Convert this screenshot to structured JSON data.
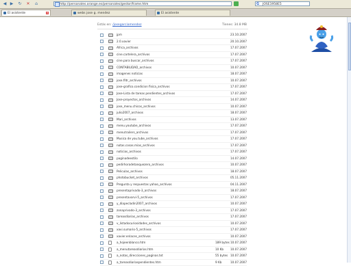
{
  "browser": {
    "address": "http://personales.orange.es/personales/gestor/frame.htm",
    "search_value": "JOSE1958E5",
    "tabs": [
      {
        "label": "El asistente",
        "active": true
      },
      {
        "label": "webs jose g. mendez",
        "active": false
      },
      {
        "label": "El asistente",
        "active": false
      }
    ]
  },
  "file_list": {
    "path_label": "Estás en:",
    "path_link": "/josegarciamendez",
    "space_label": "Tienes: 34.8 MB",
    "rows": [
      {
        "name": "jpm",
        "size": "",
        "date": "23.10.2007",
        "type": "folder"
      },
      {
        "name": "2.0.xavier",
        "size": "",
        "date": "20.10.2007",
        "type": "folder"
      },
      {
        "name": "Africa_archivos",
        "size": "",
        "date": "17.07.2007",
        "type": "folder"
      },
      {
        "name": "cine.cartelera_archivos",
        "size": "",
        "date": "17.07.2007",
        "type": "folder"
      },
      {
        "name": "cine.para buscar_archivos",
        "size": "",
        "date": "17.07.2007",
        "type": "folder"
      },
      {
        "name": "CONTABILIDAD_archivos",
        "size": "",
        "date": "10.07.2007",
        "type": "folder"
      },
      {
        "name": "imagenes noticias",
        "size": "",
        "date": "18.07.2007",
        "type": "folder"
      },
      {
        "name": "jose.filtr_archivos",
        "size": "",
        "date": "10.07.2007",
        "type": "folder"
      },
      {
        "name": "jose-grafico.condicion fisica_archivos",
        "size": "",
        "date": "17.07.2007",
        "type": "folder"
      },
      {
        "name": "Jose-Lista de tareas pendientes_archivos",
        "size": "",
        "date": "17.07.2007",
        "type": "folder"
      },
      {
        "name": "Jose-proyectos_archivos",
        "size": "",
        "date": "14.07.2007",
        "type": "folder"
      },
      {
        "name": "jose_menu.chicos_archivos",
        "size": "",
        "date": "10.07.2007",
        "type": "folder"
      },
      {
        "name": "julio2007_archivos",
        "size": "",
        "date": "18.07.2007",
        "type": "folder"
      },
      {
        "name": "Mari_archivos",
        "size": "",
        "date": "13.07.2007",
        "type": "folder"
      },
      {
        "name": "menu.youtube_archivos",
        "size": "",
        "date": "17.07.2007",
        "type": "folder"
      },
      {
        "name": "menutrailers_archivos",
        "size": "",
        "date": "17.07.2007",
        "type": "folder"
      },
      {
        "name": "Musica de you.tube_archivos",
        "size": "",
        "date": "17.07.2007",
        "type": "folder"
      },
      {
        "name": "notas.cosas.mias_archivos",
        "size": "",
        "date": "17.07.2007",
        "type": "folder"
      },
      {
        "name": "noticias_archivos",
        "size": "",
        "date": "17.07.2007",
        "type": "folder"
      },
      {
        "name": "paginadeestilo",
        "size": "",
        "date": "14.07.2007",
        "type": "folder"
      },
      {
        "name": "pedirhoradetanquezero_archivos",
        "size": "",
        "date": "10.07.2007",
        "type": "folder"
      },
      {
        "name": "Peliculas_archivos",
        "size": "",
        "date": "18.07.2007",
        "type": "folder"
      },
      {
        "name": "photobucket_archivos",
        "size": "",
        "date": "05.11.2007",
        "type": "folder"
      },
      {
        "name": "Pregunta y respuestas yahoo_archivos",
        "size": "",
        "date": "04.11.2007",
        "type": "folder"
      },
      {
        "name": "presentaprivado-3_archivos",
        "size": "",
        "date": "18.07.2007",
        "type": "folder"
      },
      {
        "name": "presentavarvi-5_archivos",
        "size": "",
        "date": "17.07.2007",
        "type": "folder"
      },
      {
        "name": "y_diapecladin2007_archivos",
        "size": "",
        "date": "10.07.2007",
        "type": "folder"
      },
      {
        "name": "zonaprivado-3_archivos",
        "size": "",
        "date": "17.07.2007",
        "type": "folder"
      },
      {
        "name": "tareasdiarias_archivos",
        "size": "",
        "date": "17.07.2007",
        "type": "folder"
      },
      {
        "name": "v_listadocuriosidades_archivos",
        "size": "",
        "date": "10.07.2007",
        "type": "folder"
      },
      {
        "name": "xavi.sumario-5_archivos",
        "size": "",
        "date": "17.07.2007",
        "type": "folder"
      },
      {
        "name": "xavier.enlaces_archivos",
        "size": "",
        "date": "10.07.2007",
        "type": "folder"
      },
      {
        "name": "a_hojeenblanco.htm",
        "size": "189 bytes",
        "date": "10.07.2007",
        "type": "file"
      },
      {
        "name": "a_menutareasdiarias.htm",
        "size": "10 Kb",
        "date": "10.07.2007",
        "type": "file"
      },
      {
        "name": "a_notas_direcciones_paginas.txt",
        "size": "55 bytes",
        "date": "10.07.2007",
        "type": "file"
      },
      {
        "name": "a_tareasdiariaspendientes.htm",
        "size": "9 Kb",
        "date": "10.07.2007",
        "type": "file"
      }
    ]
  }
}
